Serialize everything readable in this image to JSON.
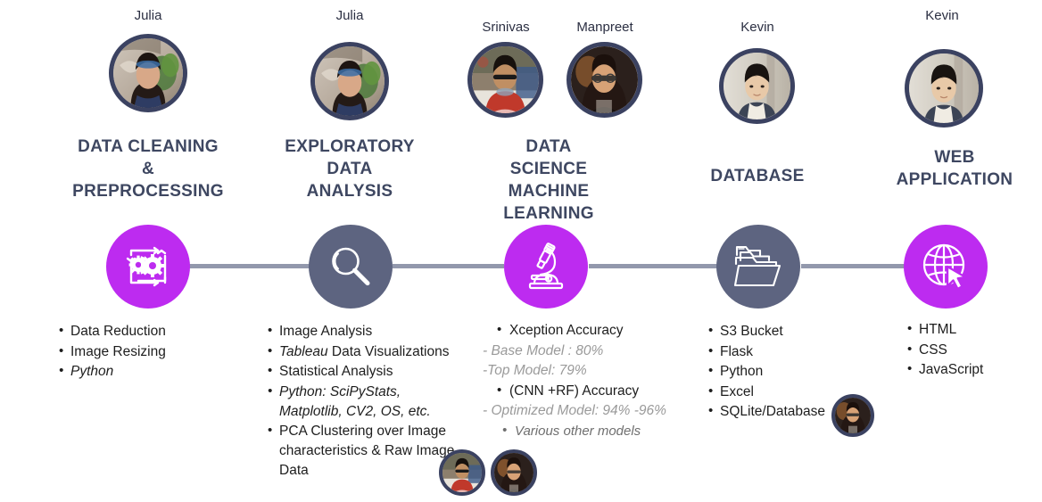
{
  "diagram": {
    "title": "Data Science Project Pipeline",
    "colors": {
      "accent_purple": "#bd2bf0",
      "slate": "#5d6480",
      "title_navy": "#3e4761",
      "connector": "#9298ac",
      "avatar_ring": "#3b4261",
      "muted_text": "#9a9a9a"
    },
    "stages": [
      {
        "id": "data-cleaning",
        "title": "DATA CLEANING\n&\nPREPROCESSING",
        "title_lines": [
          "DATA CLEANING",
          "&",
          "PREPROCESSING"
        ],
        "owner": "Julia",
        "icon": "gears-refresh-icon",
        "icon_style": "purple",
        "items": [
          {
            "text": "Data Reduction",
            "italic": false
          },
          {
            "text": "Image Resizing",
            "italic": false
          },
          {
            "text": "Python",
            "italic": true
          }
        ]
      },
      {
        "id": "eda",
        "title_lines": [
          "EXPLORATORY",
          "DATA",
          "ANALYSIS"
        ],
        "owner": "Julia",
        "icon": "magnifier-icon",
        "icon_style": "slate",
        "items": [
          {
            "text": "Image Analysis",
            "italic": false
          },
          {
            "text": "Tableau Data Visualizations",
            "italic": "partial",
            "italic_part": "Tableau",
            "rest": " Data Visualizations"
          },
          {
            "text": "Statistical Analysis",
            "italic": false
          },
          {
            "text": "Python: SciPyStats, Matplotlib, CV2, OS, etc.",
            "italic": true
          },
          {
            "text": "PCA Clustering over Image characteristics & Raw Image Data",
            "italic": false
          }
        ]
      },
      {
        "id": "ds-ml",
        "title_lines": [
          "DATA",
          "SCIENCE",
          "MACHINE",
          "LEARNING"
        ],
        "owners": [
          "Srinivas",
          "Manpreet"
        ],
        "icon": "microscope-icon",
        "icon_style": "purple",
        "items": [
          {
            "kind": "bullet",
            "text": "Xception Accuracy"
          },
          {
            "kind": "dash",
            "text": "- Base Model : 80%"
          },
          {
            "kind": "dash",
            "text": "-Top Model: 79%"
          },
          {
            "kind": "bullet",
            "text": "(CNN +RF) Accuracy"
          },
          {
            "kind": "dash",
            "text": "- Optimized Model: 94% -96%"
          },
          {
            "kind": "bullet-muted",
            "text": "Various other models"
          }
        ]
      },
      {
        "id": "database",
        "title_lines": [
          "DATABASE"
        ],
        "owner": "Kevin",
        "icon": "folder-files-icon",
        "icon_style": "slate",
        "items": [
          {
            "text": "S3 Bucket",
            "italic": false
          },
          {
            "text": "Flask",
            "italic": false
          },
          {
            "text": "Python",
            "italic": false
          },
          {
            "text": "Excel",
            "italic": false
          },
          {
            "text": "SQLite/Database",
            "italic": false
          }
        ]
      },
      {
        "id": "web-app",
        "title_lines": [
          "WEB",
          "APPLICATION"
        ],
        "owner": "Kevin",
        "icon": "globe-cursor-icon",
        "icon_style": "purple",
        "items": [
          {
            "text": "HTML",
            "italic": false
          },
          {
            "text": "CSS",
            "italic": false
          },
          {
            "text": "JavaScript",
            "italic": false
          }
        ]
      }
    ],
    "inline_avatars": [
      {
        "id": "eda-srinivas",
        "person": "Srinivas"
      },
      {
        "id": "eda-manpreet",
        "person": "Manpreet"
      },
      {
        "id": "db-manpreet",
        "person": "Manpreet"
      }
    ]
  }
}
